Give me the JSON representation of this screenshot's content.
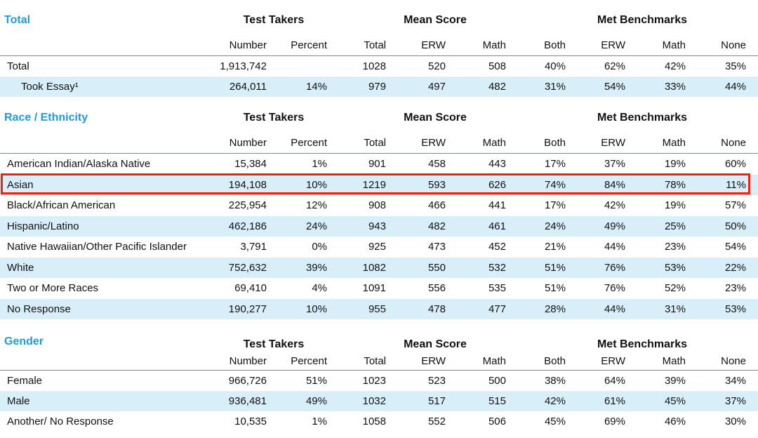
{
  "columns": {
    "groups": {
      "test_takers": "Test Takers",
      "mean_score": "Mean Score",
      "met_benchmarks": "Met Benchmarks"
    },
    "sub": [
      "Number",
      "Percent",
      "Total",
      "ERW",
      "Math",
      "Both",
      "ERW",
      "Math",
      "None"
    ]
  },
  "sections": {
    "total": {
      "title": "Total",
      "rows": [
        {
          "label": "Total",
          "cells": [
            "1,913,742",
            "",
            "1028",
            "520",
            "508",
            "40%",
            "62%",
            "42%",
            "35%"
          ]
        },
        {
          "label": "Took Essay¹",
          "cells": [
            "264,011",
            "14%",
            "979",
            "497",
            "482",
            "31%",
            "54%",
            "33%",
            "44%"
          ]
        }
      ]
    },
    "race": {
      "title": "Race / Ethnicity",
      "rows": [
        {
          "label": "American Indian/Alaska Native",
          "cells": [
            "15,384",
            "1%",
            "901",
            "458",
            "443",
            "17%",
            "37%",
            "19%",
            "60%"
          ]
        },
        {
          "label": "Asian",
          "cells": [
            "194,108",
            "10%",
            "1219",
            "593",
            "626",
            "74%",
            "84%",
            "78%",
            "11%"
          ]
        },
        {
          "label": "Black/African American",
          "cells": [
            "225,954",
            "12%",
            "908",
            "466",
            "441",
            "17%",
            "42%",
            "19%",
            "57%"
          ]
        },
        {
          "label": "Hispanic/Latino",
          "cells": [
            "462,186",
            "24%",
            "943",
            "482",
            "461",
            "24%",
            "49%",
            "25%",
            "50%"
          ]
        },
        {
          "label": "Native Hawaiian/Other Pacific Islander",
          "cells": [
            "3,791",
            "0%",
            "925",
            "473",
            "452",
            "21%",
            "44%",
            "23%",
            "54%"
          ]
        },
        {
          "label": "White",
          "cells": [
            "752,632",
            "39%",
            "1082",
            "550",
            "532",
            "51%",
            "76%",
            "53%",
            "22%"
          ]
        },
        {
          "label": "Two or More Races",
          "cells": [
            "69,410",
            "4%",
            "1091",
            "556",
            "535",
            "51%",
            "76%",
            "52%",
            "23%"
          ]
        },
        {
          "label": "No Response",
          "cells": [
            "190,277",
            "10%",
            "955",
            "478",
            "477",
            "28%",
            "44%",
            "31%",
            "53%"
          ]
        }
      ]
    },
    "gender": {
      "title": "Gender",
      "rows": [
        {
          "label": "Female",
          "cells": [
            "966,726",
            "51%",
            "1023",
            "523",
            "500",
            "38%",
            "64%",
            "39%",
            "34%"
          ]
        },
        {
          "label": "Male",
          "cells": [
            "936,481",
            "49%",
            "1032",
            "517",
            "515",
            "42%",
            "61%",
            "45%",
            "37%"
          ]
        },
        {
          "label": "Another/ No Response",
          "cells": [
            "10,535",
            "1%",
            "1058",
            "552",
            "506",
            "45%",
            "69%",
            "46%",
            "30%"
          ]
        }
      ]
    }
  },
  "highlight": {
    "section": "race",
    "row_label": "Asian",
    "color": "#ee2211"
  },
  "colors": {
    "section_title": "#1f9bd7",
    "row_shade": "#d8eef9"
  }
}
